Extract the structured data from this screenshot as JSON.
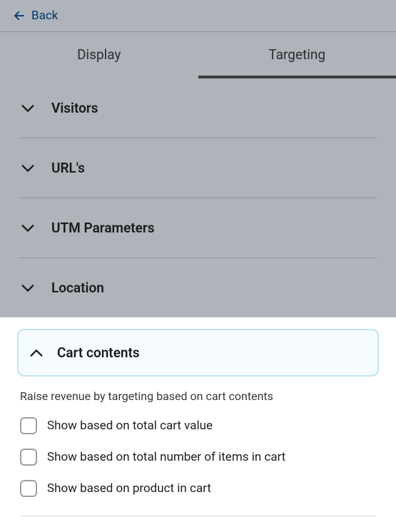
{
  "header": {
    "back_label": "Back"
  },
  "tabs": {
    "display": "Display",
    "targeting": "Targeting"
  },
  "accordion": {
    "visitors": "Visitors",
    "urls": "URL's",
    "utm": "UTM Parameters",
    "location": "Location",
    "cart": "Cart contents"
  },
  "cart": {
    "help": "Raise revenue by targeting based on cart contents",
    "opt_value": "Show based on total cart value",
    "opt_items": "Show based on total number of items in cart",
    "opt_product": "Show based on product in cart"
  },
  "colors": {
    "back_link": "#003a70",
    "highlight_border": "#bfe4f3"
  }
}
